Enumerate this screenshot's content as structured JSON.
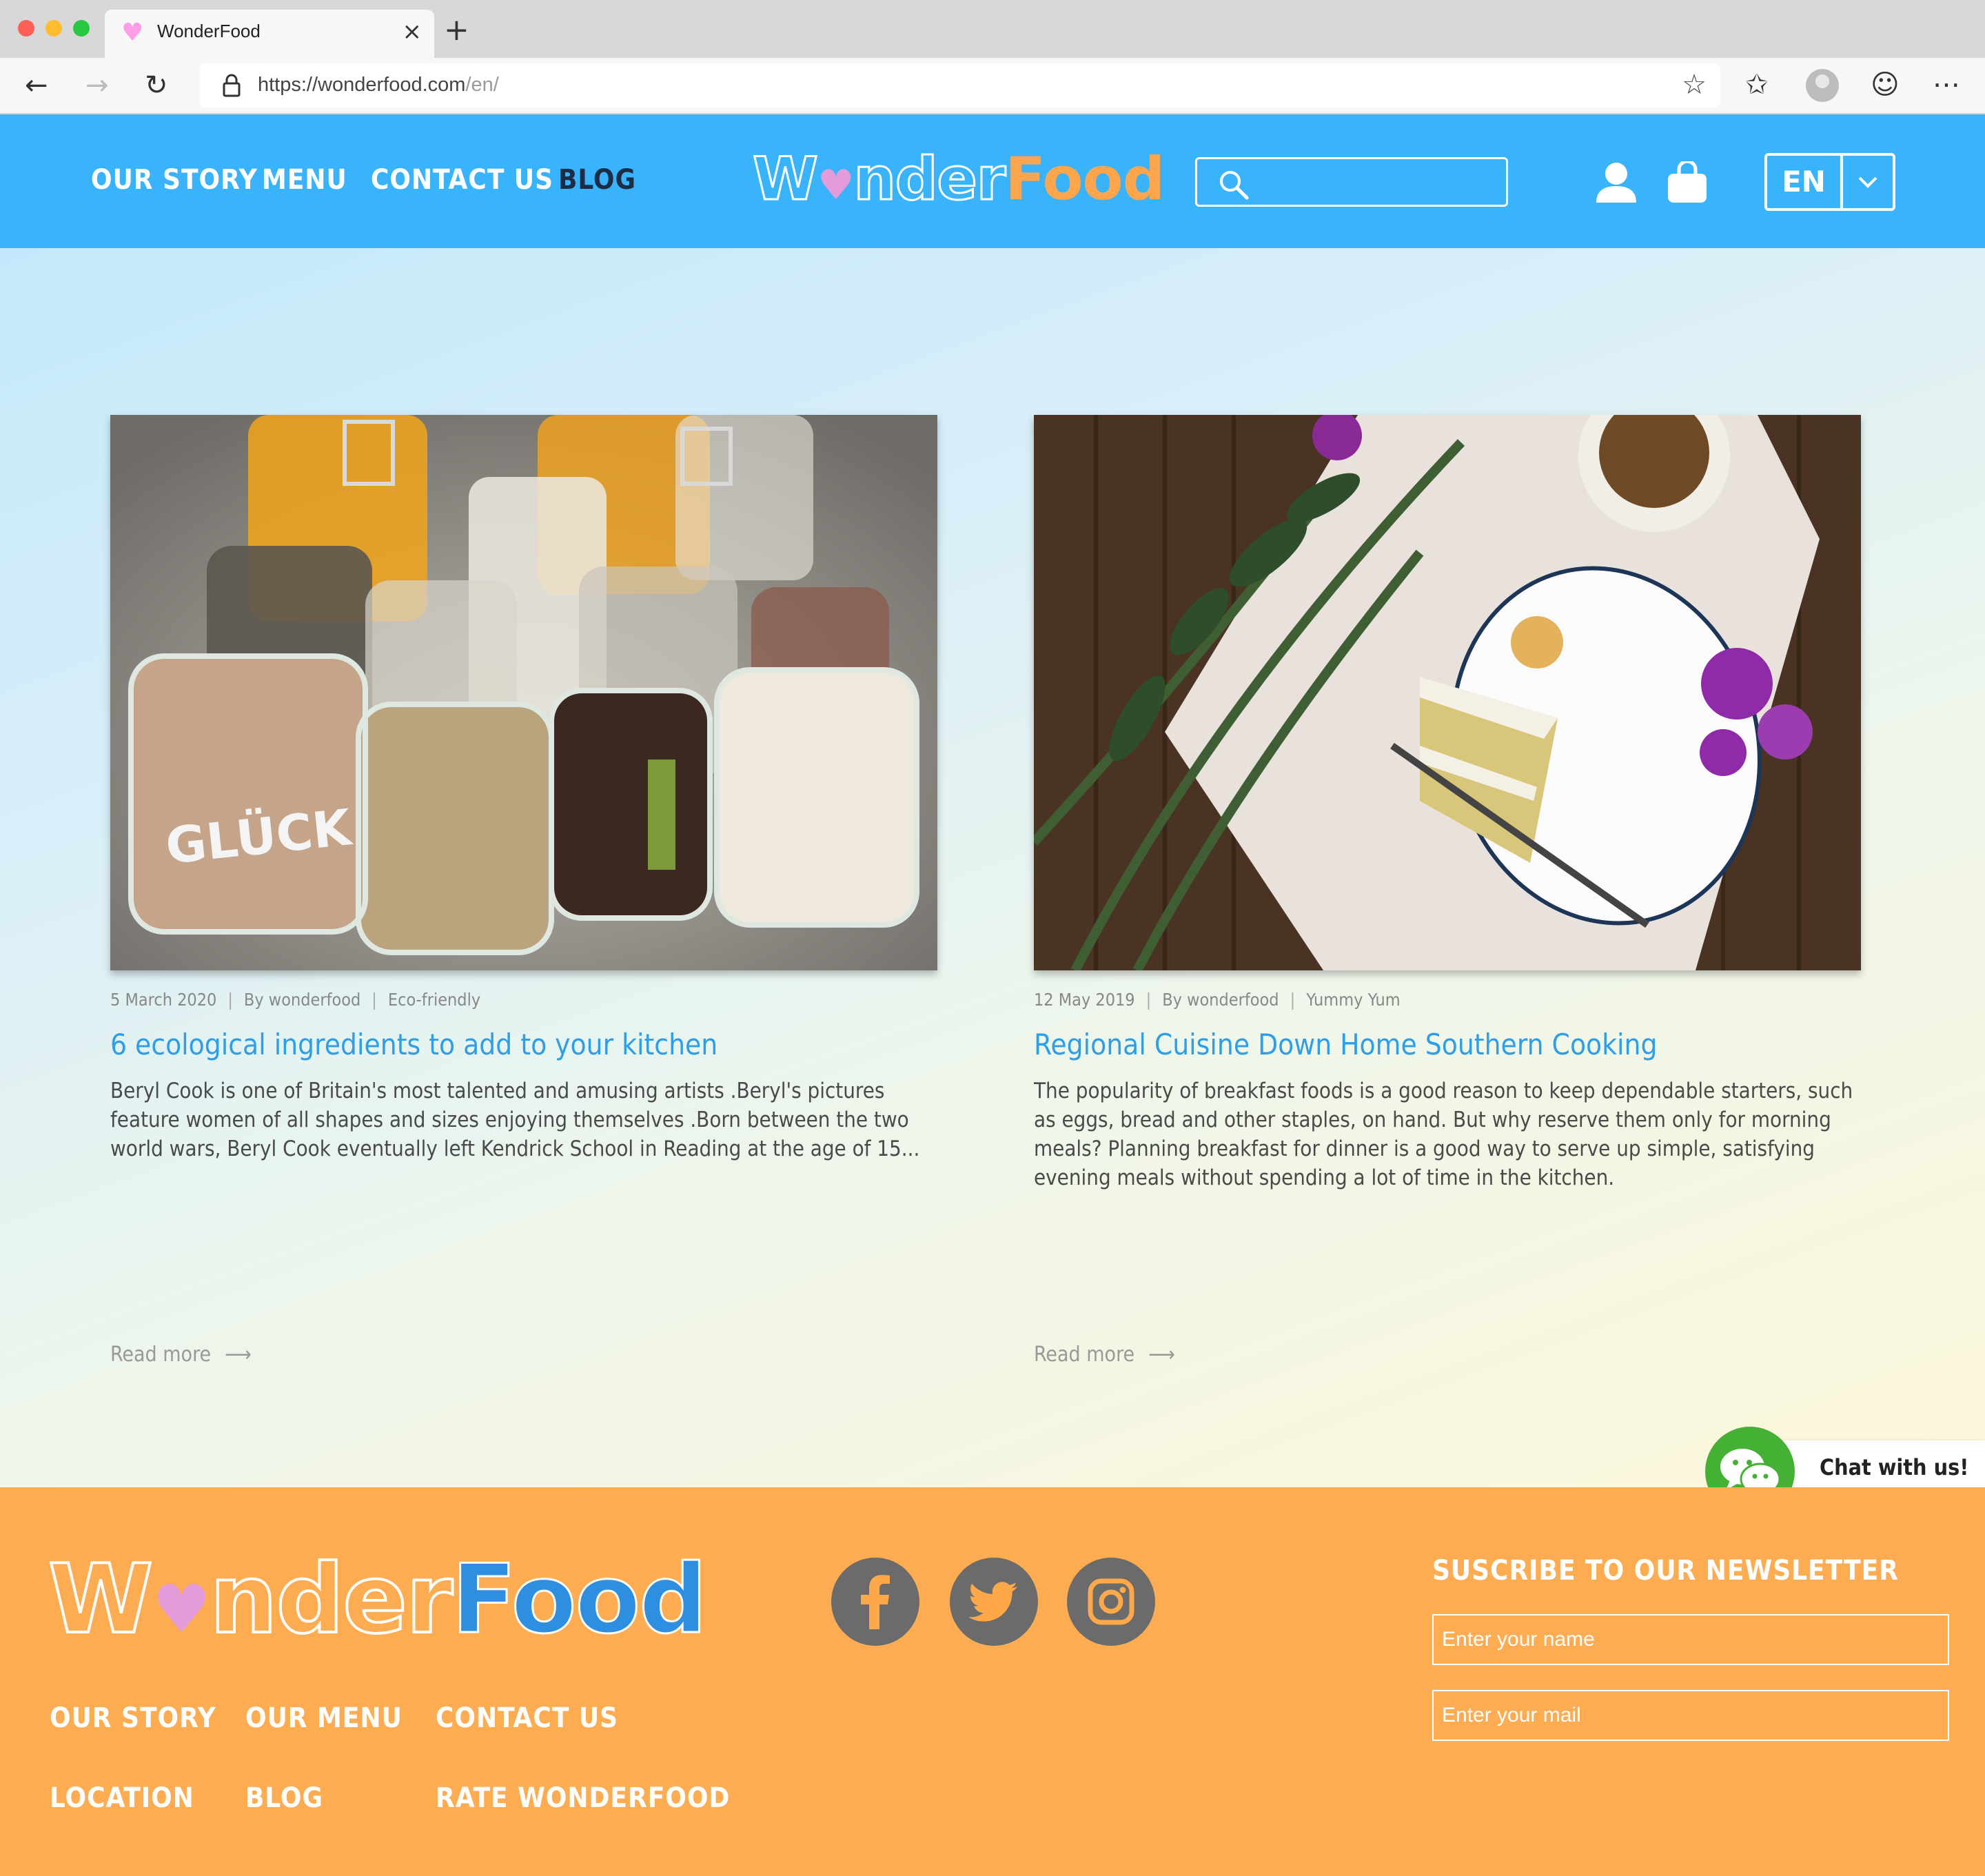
{
  "browser": {
    "tab_title": "WonderFood",
    "url_main": "https://wonderfood.com",
    "url_path": "/en/"
  },
  "header": {
    "nav": [
      "OUR STORY",
      "MENU",
      "CONTACT US",
      "BLOG"
    ],
    "active_nav": "BLOG",
    "logo_part1": "Wonder",
    "logo_part2": "Food",
    "search_value": "",
    "language": "EN"
  },
  "posts": [
    {
      "date": "5 March 2020",
      "author": "By wonderfood",
      "category": "Eco-friendly",
      "title": "6 ecological ingredients to add to your kitchen",
      "excerpt": "Beryl Cook is one of Britain's most talented and amusing artists .Beryl's pictures feature women of all shapes and sizes enjoying themselves .Born between the two world wars, Beryl Cook eventually left Kendrick School in Reading at the age of 15...",
      "read_more": "Read more",
      "image_text": "GLÜCK"
    },
    {
      "date": "12 May 2019",
      "author": "By wonderfood",
      "category": "Yummy Yum",
      "title": "Regional Cuisine Down Home Southern Cooking",
      "excerpt": "The popularity of breakfast foods is a good reason to keep dependable starters, such as eggs, bread and other staples, on hand. But why reserve them only for morning meals? Planning breakfast for dinner is a good way to serve up simple, satisfying evening meals without spending a lot of time in the kitchen.",
      "read_more": "Read more"
    }
  ],
  "chat": {
    "label": "Chat with us!"
  },
  "footer": {
    "logo_part1": "Wonder",
    "logo_part2": "Food",
    "links": [
      "OUR STORY",
      "OUR MENU",
      "CONTACT US",
      "LOCATION",
      "BLOG",
      "RATE WONDERFOOD"
    ],
    "social": [
      "facebook-icon",
      "twitter-icon",
      "instagram-icon"
    ],
    "newsletter_title": "SUSCRIBE TO OUR NEWSLETTER",
    "name_placeholder": "Enter your name",
    "mail_placeholder": "Enter your mail"
  },
  "colors": {
    "header": "#39b3fc",
    "footer": "#feac52",
    "title_blue": "#2e9ee8",
    "chat_green": "#44b034"
  }
}
